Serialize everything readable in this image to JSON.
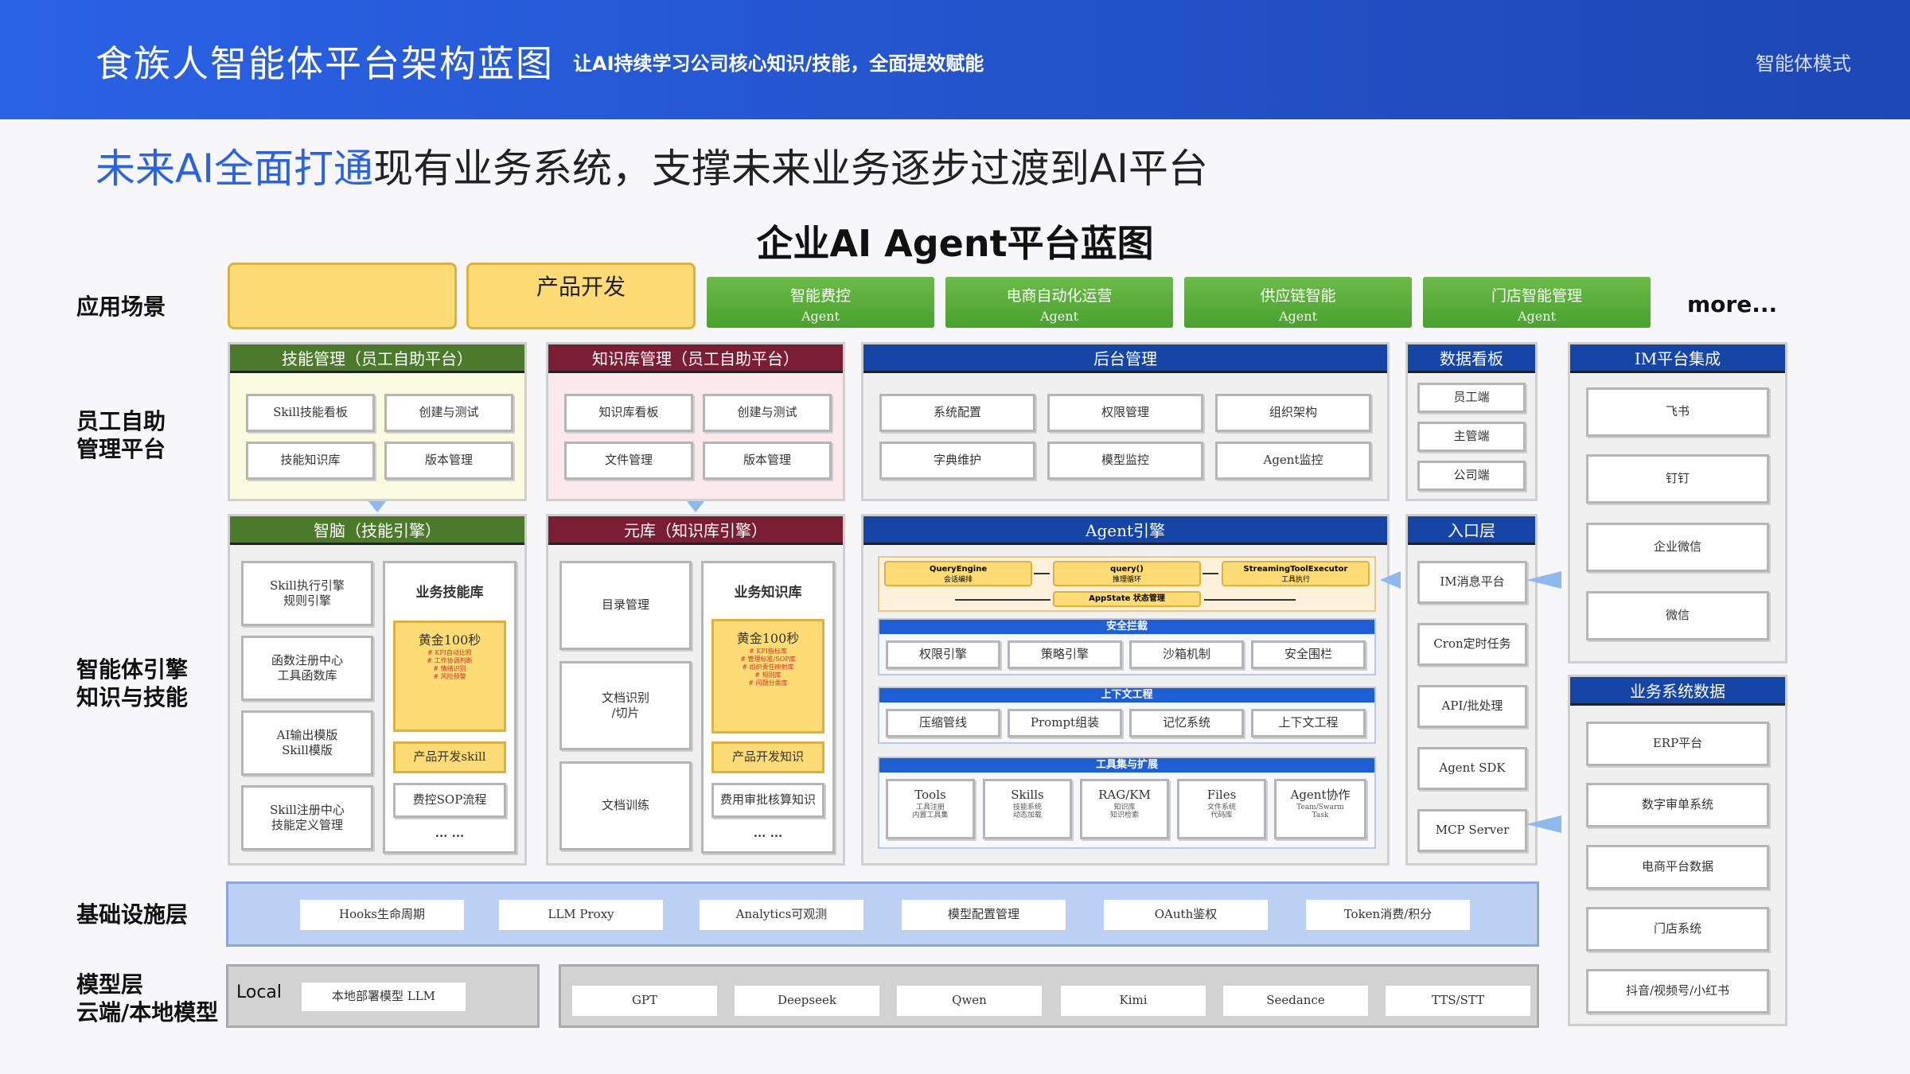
{
  "header": {
    "title": "食族人智能体平台架构蓝图",
    "subtitle": "让AI持续学习公司核心知识/技能，全面提效赋能",
    "mode": "智能体模式"
  },
  "headline": {
    "blue": "未来AI全面打通",
    "rest": "现有业务系统，支撑未来业务逐步过渡到AI平台"
  },
  "diagram_title": "企业AI Agent平台蓝图",
  "rows": {
    "app": "应用场景",
    "self1": "员工自助",
    "self2": "管理平台",
    "eng1": "智能体引擎",
    "eng2": "知识与技能",
    "infra": "基础设施层",
    "model1": "模型层",
    "model2": "云端/本地模型"
  },
  "apps": {
    "product": "产品开发",
    "more": "more...",
    "agents": [
      {
        "name": "智能费控",
        "sub": "Agent"
      },
      {
        "name": "电商自动化运营",
        "sub": "Agent"
      },
      {
        "name": "供应链智能",
        "sub": "Agent"
      },
      {
        "name": "门店智能管理",
        "sub": "Agent"
      }
    ]
  },
  "skill_mgmt": {
    "title": "技能管理（员工自助平台）",
    "items": [
      "Skill技能看板",
      "创建与测试",
      "技能知识库",
      "版本管理"
    ]
  },
  "kb_mgmt": {
    "title": "知识库管理（员工自助平台）",
    "items": [
      "知识库看板",
      "创建与测试",
      "文件管理",
      "版本管理"
    ]
  },
  "backend": {
    "title": "后台管理",
    "items": [
      "系统配置",
      "权限管理",
      "组织架构",
      "字典维护",
      "模型监控",
      "Agent监控"
    ]
  },
  "dashboard": {
    "title": "数据看板",
    "items": [
      "员工端",
      "主管端",
      "公司端"
    ]
  },
  "im": {
    "title": "IM平台集成",
    "items": [
      "飞书",
      "钉钉",
      "企业微信",
      "微信"
    ]
  },
  "brain": {
    "title": "智脑（技能引擎）",
    "left": [
      "Skill执行引擎\n规则引擎",
      "函数注册中心\n工具函数库",
      "AI输出模版\nSkill模版",
      "Skill注册中心\n技能定义管理"
    ],
    "lib_title": "业务技能库",
    "gold": "黄金100秒",
    "gold_items": [
      "# KPI自动比照",
      "# 工作协调判断",
      "# 情绪识别",
      "# 风险预警"
    ],
    "prod": "产品开发skill",
    "sop": "费控SOP流程",
    "ellipsis": "... ..."
  },
  "yuanku": {
    "title": "元库（知识库引擎）",
    "left": [
      "目录管理",
      "文档识别\n/切片",
      "文档训练"
    ],
    "lib_title": "业务知识库",
    "gold": "黄金100秒",
    "gold_items": [
      "# KPI指标库",
      "# 管理标准/SOP库",
      "# 组织责任映射库",
      "# 规则库",
      "# 问题分类库"
    ],
    "prod": "产品开发知识",
    "fee": "费用审批核算知识",
    "ellipsis": "... ..."
  },
  "agent_engine": {
    "title": "Agent引擎",
    "loop": {
      "qe": "QueryEngine",
      "qe2": "会话编排",
      "q": "query()",
      "q2": "推理循环",
      "st": "StreamingToolExecutor",
      "st2": "工具执行",
      "app": "AppState 状态管理"
    },
    "security": {
      "title": "安全拦截",
      "items": [
        "权限引擎",
        "策略引擎",
        "沙箱机制",
        "安全围栏"
      ]
    },
    "context": {
      "title": "上下文工程",
      "items": [
        "压缩管线",
        "Prompt组装",
        "记忆系统",
        "上下文工程"
      ]
    },
    "tools": {
      "title": "工具集与扩展",
      "items": [
        {
          "n": "Tools",
          "d": "工具注册\n内置工具集"
        },
        {
          "n": "Skills",
          "d": "技能系统\n动态加载"
        },
        {
          "n": "RAG/KM",
          "d": "知识库\n知识检索"
        },
        {
          "n": "Files",
          "d": "文件系统\n代码库"
        },
        {
          "n": "Agent协作",
          "d": "Team/Swarm\nTask"
        }
      ]
    }
  },
  "entry": {
    "title": "入口层",
    "items": [
      "IM消息平台",
      "Cron定时任务",
      "API/批处理",
      "Agent SDK",
      "MCP Server"
    ]
  },
  "biz": {
    "title": "业务系统数据",
    "items": [
      "ERP平台",
      "数字审单系统",
      "电商平台数据",
      "门店系统",
      "抖音/视频号/小红书"
    ]
  },
  "infra": {
    "items": [
      "Hooks生命周期",
      "LLM Proxy",
      "Analytics可观测",
      "模型配置管理",
      "OAuth鉴权",
      "Token消费/积分"
    ]
  },
  "models": {
    "local_label": "Local",
    "local": "本地部署模型 LLM",
    "cloud": [
      "GPT",
      "Deepseek",
      "Qwen",
      "Kimi",
      "Seedance",
      "TTS/STT"
    ]
  },
  "colors": {
    "green": "#4b7a2b",
    "maroon": "#7c1e33",
    "navy": "#1545a6",
    "blue": "#2a62e6"
  }
}
